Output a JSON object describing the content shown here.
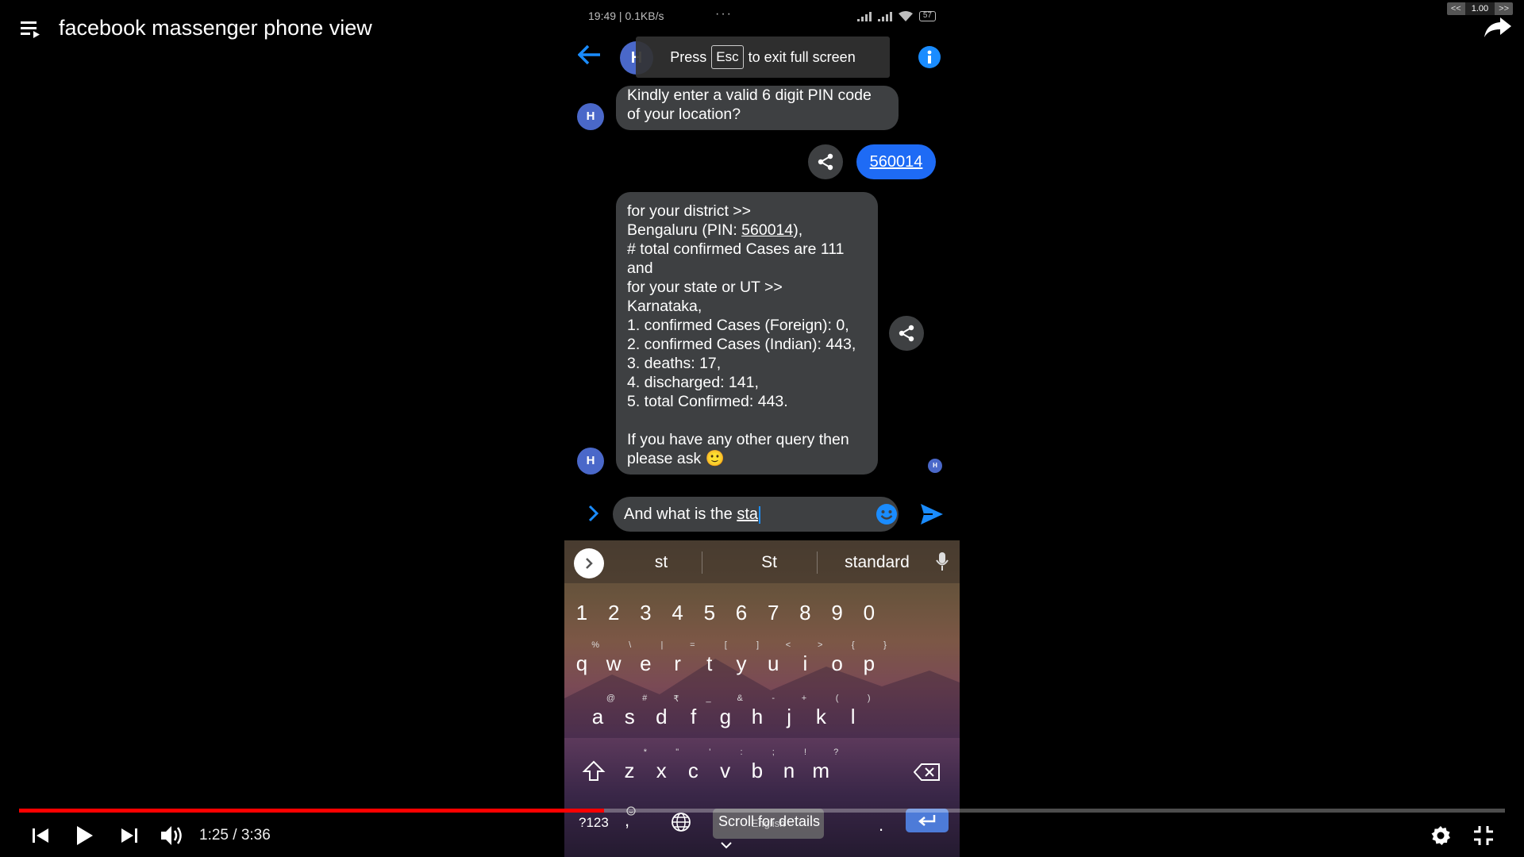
{
  "player": {
    "title": "facebook massenger phone view",
    "speed": {
      "dec": "<<",
      "value": "1.00",
      "inc": ">>"
    },
    "time": "1:25 / 3:36",
    "progress": 0.3935
  },
  "status_bar": {
    "left": "19:49 | 0.1KB/s",
    "dots": "···",
    "battery": "57"
  },
  "header": {
    "avatar_letter": "H",
    "toast": {
      "press": "Press",
      "key": "Esc",
      "rest": "to exit full screen"
    }
  },
  "messages": {
    "bot1": {
      "avatar": "H",
      "lines": [
        "Kindly enter a valid 6 digit PIN code",
        "of your location?"
      ]
    },
    "user1": "560014",
    "bot2": {
      "avatar": "H",
      "l1": "for your district >>",
      "l2_pre": "Bengaluru (PIN: ",
      "l2_link": "560014",
      "l2_post": "),",
      "l3": "# total confirmed Cases are 111",
      "l4": "and",
      "l5": "for your state or UT >>",
      "l6": "Karnataka,",
      "l7": "1. confirmed Cases (Foreign): 0,",
      "l8": "2. confirmed Cases (Indian): 443,",
      "l9": "3. deaths: 17,",
      "l10": "4. discharged: 141,",
      "l11": "5. total Confirmed: 443.",
      "l12": "If you have any other query then",
      "l13": "please ask 🙂"
    },
    "seen_avatar": "H"
  },
  "compose": {
    "text_pre": "And what is the ",
    "text_tail": "sta"
  },
  "keyboard": {
    "suggestions": [
      "st",
      "St",
      "standard"
    ],
    "numbers": [
      "1",
      "2",
      "3",
      "4",
      "5",
      "6",
      "7",
      "8",
      "9",
      "0"
    ],
    "row1": [
      {
        "k": "q",
        "h": "%"
      },
      {
        "k": "w",
        "h": "\\"
      },
      {
        "k": "e",
        "h": "|"
      },
      {
        "k": "r",
        "h": "="
      },
      {
        "k": "t",
        "h": "["
      },
      {
        "k": "y",
        "h": "]"
      },
      {
        "k": "u",
        "h": "<"
      },
      {
        "k": "i",
        "h": ">"
      },
      {
        "k": "o",
        "h": "{"
      },
      {
        "k": "p",
        "h": "}"
      }
    ],
    "row2": [
      {
        "k": "a",
        "h": "@"
      },
      {
        "k": "s",
        "h": "#"
      },
      {
        "k": "d",
        "h": "₹"
      },
      {
        "k": "f",
        "h": "_"
      },
      {
        "k": "g",
        "h": "&"
      },
      {
        "k": "h",
        "h": "-"
      },
      {
        "k": "j",
        "h": "+"
      },
      {
        "k": "k",
        "h": "("
      },
      {
        "k": "l",
        "h": ")"
      }
    ],
    "row3": [
      {
        "k": "z",
        "h": "*"
      },
      {
        "k": "x",
        "h": "\""
      },
      {
        "k": "c",
        "h": "'"
      },
      {
        "k": "v",
        "h": ":"
      },
      {
        "k": "b",
        "h": ";"
      },
      {
        "k": "n",
        "h": "!"
      },
      {
        "k": "m",
        "h": "?"
      }
    ],
    "symbols_key": "?123",
    "comma": ",",
    "period": ".",
    "space_label": "English",
    "scroll_tip": "Scroll for details"
  }
}
